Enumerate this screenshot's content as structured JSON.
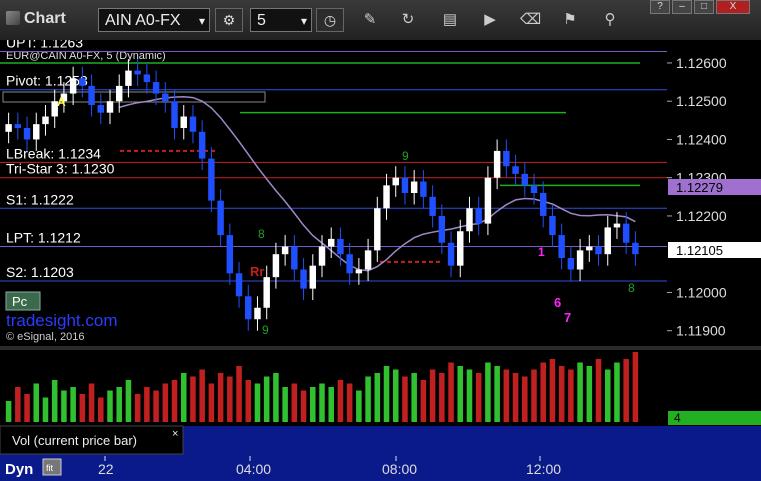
{
  "toolbar": {
    "title": "Chart",
    "symbol": "AIN A0-FX",
    "interval": "5",
    "dropdown_arrow": "▾",
    "icons": [
      "settings-icon",
      "clock-icon",
      "pencil-icon",
      "refresh-icon",
      "calendar-icon",
      "play-icon",
      "eraser-icon",
      "flag-icon",
      "pin-icon"
    ]
  },
  "window_buttons": {
    "help": "?",
    "minimize": "–",
    "maximize": "□",
    "close": "X"
  },
  "colors": {
    "up_candle": "#ffffff",
    "down_candle": "#1f4fff",
    "pivot_line": "#7a58c8",
    "green_level": "#1db01d",
    "red_level": "#c82020",
    "blue_level": "#2f4fe0",
    "ma": "#a088c8",
    "seq_green": "#22a022",
    "seq_magenta": "#ff22ff",
    "vol_up": "#30c030",
    "vol_down": "#c02020",
    "price_label": "#ffffff",
    "ma_label": "#a070d0"
  },
  "chart_data": {
    "type": "candlestick",
    "symbol_label": "EUR@CAIN A0-FX, 5 (Dynamic)",
    "ylim": [
      1.1186,
      1.1266
    ],
    "price_ticks": [
      "1.12600",
      "1.12500",
      "1.12400",
      "1.12300",
      "1.12200",
      "1.12000",
      "1.11900"
    ],
    "time_ticks": [
      "22",
      "04:00",
      "08:00",
      "12:00"
    ],
    "current_price": "1.12105",
    "ma_value": "1.12279",
    "levels": [
      {
        "label": "UPT: 1.1263",
        "value": 1.1263
      },
      {
        "label": "Pivot: 1.1253",
        "value": 1.1253
      },
      {
        "label": "LBreak: 1.1234",
        "value": 1.1234
      },
      {
        "label": "Tri-Star 3: 1.1230",
        "value": 1.123
      },
      {
        "label": "S1: 1.1222",
        "value": 1.1222
      },
      {
        "label": "LPT: 1.1212",
        "value": 1.1212
      },
      {
        "label": "S2: 1.1203",
        "value": 1.1203
      }
    ],
    "close": [
      1.1244,
      1.1243,
      1.124,
      1.1244,
      1.1246,
      1.125,
      1.1252,
      1.1256,
      1.1254,
      1.1249,
      1.1247,
      1.125,
      1.1254,
      1.1258,
      1.1257,
      1.1255,
      1.1252,
      1.125,
      1.1243,
      1.1246,
      1.1242,
      1.1235,
      1.1224,
      1.1215,
      1.1205,
      1.1199,
      1.1193,
      1.1196,
      1.1204,
      1.121,
      1.1212,
      1.1206,
      1.1201,
      1.1207,
      1.1212,
      1.1214,
      1.121,
      1.1205,
      1.1206,
      1.1211,
      1.1222,
      1.1228,
      1.123,
      1.1226,
      1.1229,
      1.1225,
      1.122,
      1.1213,
      1.1207,
      1.1216,
      1.1222,
      1.1218,
      1.123,
      1.1237,
      1.1233,
      1.1231,
      1.1228,
      1.1226,
      1.122,
      1.1215,
      1.1209,
      1.1206,
      1.1211,
      1.1212,
      1.121,
      1.1217,
      1.1218,
      1.1213,
      1.121
    ],
    "volume": [
      0.3,
      0.5,
      0.4,
      0.55,
      0.35,
      0.6,
      0.45,
      0.5,
      0.4,
      0.55,
      0.35,
      0.45,
      0.5,
      0.6,
      0.4,
      0.5,
      0.45,
      0.55,
      0.6,
      0.7,
      0.65,
      0.75,
      0.55,
      0.7,
      0.65,
      0.8,
      0.6,
      0.55,
      0.65,
      0.7,
      0.5,
      0.55,
      0.45,
      0.5,
      0.55,
      0.5,
      0.6,
      0.55,
      0.45,
      0.65,
      0.7,
      0.8,
      0.75,
      0.65,
      0.7,
      0.6,
      0.75,
      0.7,
      0.85,
      0.8,
      0.75,
      0.7,
      0.85,
      0.8,
      0.75,
      0.7,
      0.65,
      0.75,
      0.85,
      0.9,
      0.8,
      0.75,
      0.85,
      0.8,
      0.9,
      0.75,
      0.85,
      0.9,
      1.0
    ],
    "vol_axis_label": "4",
    "markers": [
      {
        "text": "A",
        "color": "#ffff40"
      },
      {
        "text": "Rr",
        "color": "#c02020"
      },
      {
        "text": "9",
        "color": "#22a022"
      },
      {
        "text": "8",
        "color": "#22a022"
      },
      {
        "text": "7",
        "color": "#ff22ff"
      },
      {
        "text": "6",
        "color": "#ff22ff"
      },
      {
        "text": "1",
        "color": "#ff22ff"
      }
    ]
  },
  "overlay": {
    "watermark": "tradesight.com",
    "copyright": "© eSignal, 2016",
    "pc_button": "Pc"
  },
  "volume_panel": {
    "label": "Vol (current price bar)",
    "close": "×"
  },
  "footer": {
    "dyn": "Dyn",
    "fit": "fit"
  }
}
